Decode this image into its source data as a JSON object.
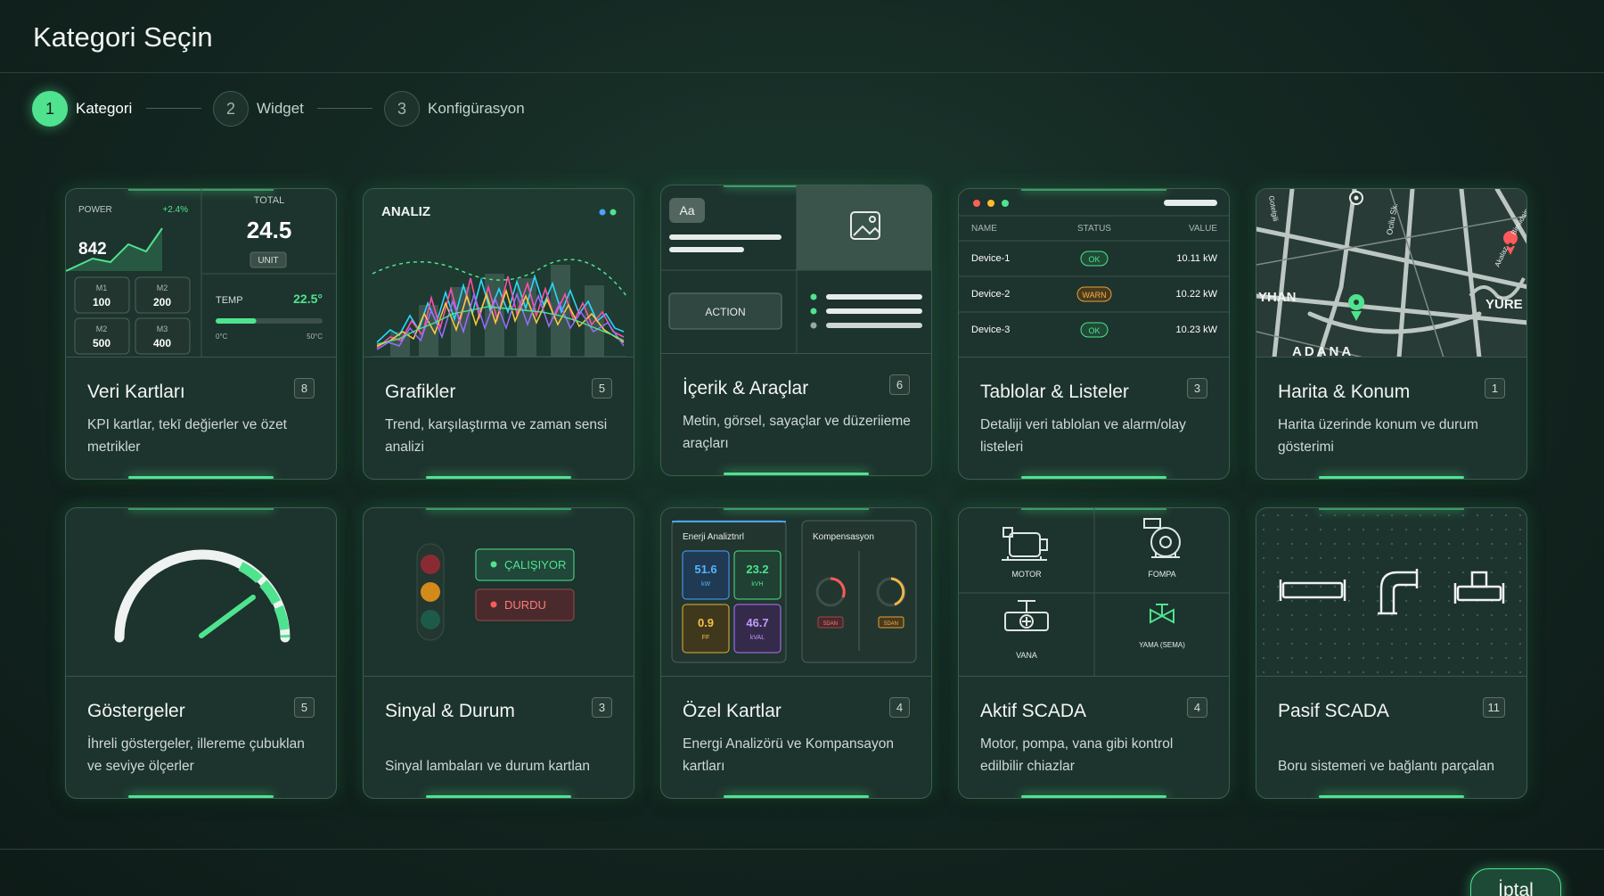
{
  "header": {
    "title": "Kategori Seçin"
  },
  "steps": [
    {
      "number": "1",
      "label": "Kategori",
      "active": true
    },
    {
      "number": "2",
      "label": "Widget",
      "active": false
    },
    {
      "number": "3",
      "label": "Konfigürasyon",
      "active": false
    }
  ],
  "cards": [
    {
      "title": "Veri Kartları",
      "count": "8",
      "description": "KPI kartlar, tekī değierler ve özet metrikler",
      "preview": {
        "power_label": "POWER",
        "power_value": "842",
        "power_delta": "+2.4%",
        "total_label": "TOTAL",
        "total_value": "24.5",
        "unit_label": "UNIT",
        "tiles": [
          {
            "label": "M1",
            "value": "100"
          },
          {
            "label": "M2",
            "value": "200"
          },
          {
            "label": "M2",
            "value": "500"
          },
          {
            "label": "M3",
            "value": "400"
          }
        ],
        "temp_label": "TEMP",
        "temp_value": "22.5°",
        "temp_min": "0°C",
        "temp_max": "50°C",
        "temp_level": 0.38
      }
    },
    {
      "title": "Grafikler",
      "count": "5",
      "description": "Trend, karşılaştırma ve zaman sensi analizi",
      "preview": {
        "label": "ANALIZ"
      }
    },
    {
      "title": "İçerik & Araçlar",
      "count": "6",
      "description": "Metin, görsel, sayaçlar ve düzeriieme araçları",
      "preview": {
        "text_badge": "Aa",
        "action_label": "ACTION"
      }
    },
    {
      "title": "Tablolar & Listeler",
      "count": "3",
      "description": "Detaliji veri tablolan ve alarm/olay listeleri",
      "preview": {
        "columns": [
          "NAME",
          "STATUS",
          "VALUE"
        ],
        "rows": [
          {
            "name": "Device-1",
            "status": "OK",
            "value": "10.11 kW"
          },
          {
            "name": "Device-2",
            "status": "WARN",
            "value": "10.22 kW"
          },
          {
            "name": "Device-3",
            "status": "OK",
            "value": "10.23 kW"
          }
        ]
      }
    },
    {
      "title": "Harita & Konum",
      "count": "1",
      "description": "Harita üzerinde konum ve durum gösterimi",
      "preview": {
        "map_labels": [
          "YHAN",
          "YÜRE",
          "ADANA",
          "Ocilu Sk.",
          "Gotelgili",
          "Akalaz",
          "Bimlidaip"
        ]
      }
    },
    {
      "title": "Göstergeler",
      "count": "5",
      "description": "İhreli göstergeler, illereme çubuklan ve seviye ölçerler",
      "preview": {
        "gauge_level": 0.66
      }
    },
    {
      "title": "Sinyal & Durum",
      "count": "3",
      "description": "Sinyal lambaları ve durum kartlan",
      "preview": {
        "running_label": "ÇALIŞIYOR",
        "stopped_label": "DURDU"
      }
    },
    {
      "title": "Özel Kartlar",
      "count": "4",
      "description": "Energi Analizörü ve Kompansayon kartları",
      "preview": {
        "energy_title": "Enerji Analiztnrl",
        "comp_title": "Kompensasyon",
        "metrics": [
          {
            "value": "51.6",
            "unit": "kW"
          },
          {
            "value": "23.2",
            "unit": "kVH"
          },
          {
            "value": "0.9",
            "unit": "FF"
          },
          {
            "value": "46.7",
            "unit": "kVAL"
          }
        ],
        "comp_status": [
          "5DAN",
          "5DAN"
        ]
      }
    },
    {
      "title": "Aktif SCADA",
      "count": "4",
      "description": "Motor, pompa, vana gibi kontrol edilbilir chiazlar",
      "preview": {
        "items": [
          "MOTOR",
          "FOMPA",
          "VANA",
          "YAMA (SEMA)"
        ]
      }
    },
    {
      "title": "Pasif SCADA",
      "count": "11",
      "description": "Boru sistemeri ve bağlantı parçalan",
      "preview": {}
    }
  ],
  "footer": {
    "cancel_label": "İptal"
  }
}
